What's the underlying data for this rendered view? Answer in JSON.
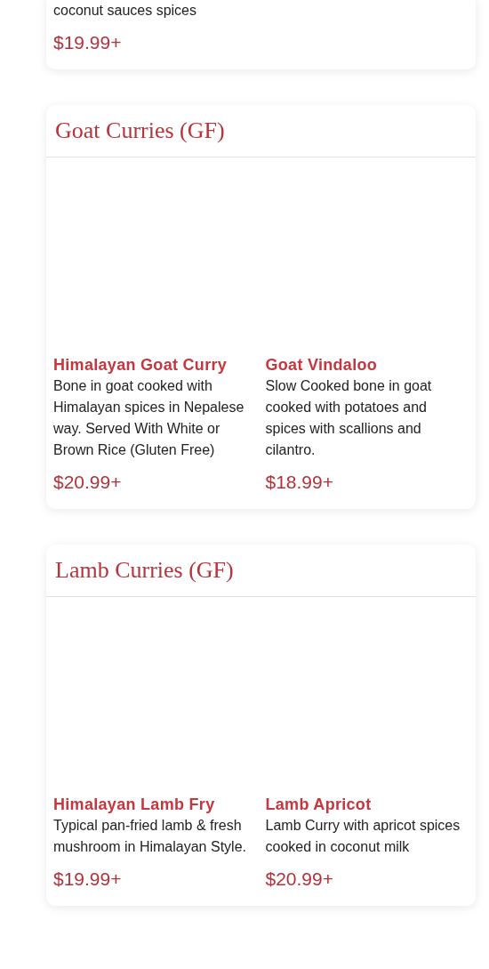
{
  "sections": [
    {
      "items": [
        {
          "description": "coconut sauces spices",
          "price": "$19.99+"
        }
      ]
    },
    {
      "title": "Goat Curries (GF)",
      "items": [
        {
          "name": "Himalayan Goat Curry",
          "description": "Bone in goat cooked with Himalayan spices in Nepalese way. Served With White or Brown Rice (Gluten Free)",
          "price": "$20.99+"
        },
        {
          "name": "Goat Vindaloo",
          "description": "Slow Cooked bone in goat cooked with potatoes and spices with scallions and cilantro.",
          "price": "$18.99+"
        }
      ]
    },
    {
      "title": "Lamb Curries (GF)",
      "items": [
        {
          "name": "Himalayan Lamb Fry",
          "description": "Typical pan-fried lamb & fresh mushroom in Himalayan Style.",
          "price": "$19.99+"
        },
        {
          "name": "Lamb Apricot",
          "description": "Lamb Curry with apricot spices cooked in coconut milk",
          "price": "$20.99+"
        }
      ]
    }
  ]
}
